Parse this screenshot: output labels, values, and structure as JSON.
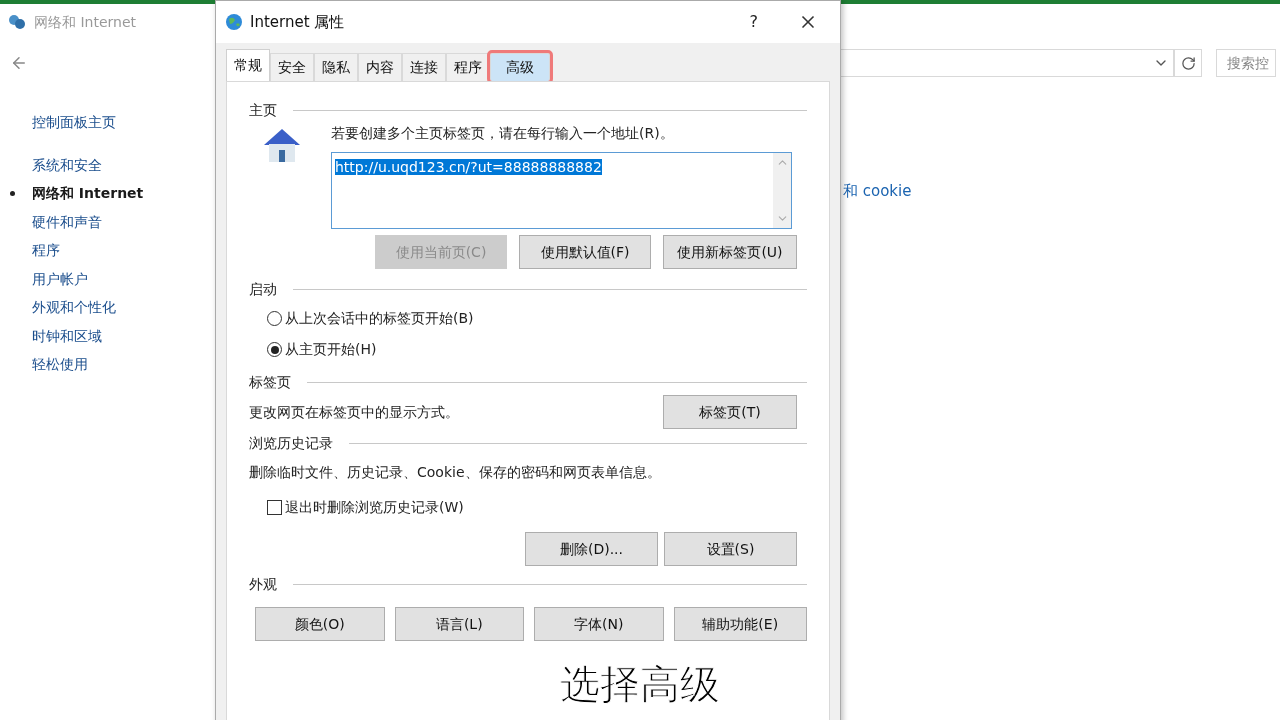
{
  "control_panel": {
    "title": "网络和 Internet",
    "sidebar": [
      {
        "label": "控制面板主页",
        "selected": false
      },
      {
        "label": "系统和安全",
        "selected": false
      },
      {
        "label": "网络和 Internet",
        "selected": true
      },
      {
        "label": "硬件和声音",
        "selected": false
      },
      {
        "label": "程序",
        "selected": false
      },
      {
        "label": "用户帐户",
        "selected": false
      },
      {
        "label": "外观和个性化",
        "selected": false
      },
      {
        "label": "时钟和区域",
        "selected": false
      },
      {
        "label": "轻松使用",
        "selected": false
      }
    ],
    "search": {
      "placeholder": "搜索控"
    },
    "link": "和 cookie"
  },
  "dialog": {
    "title": "Internet 属性",
    "help": "?",
    "tabs": [
      {
        "label": "常规",
        "selected": true,
        "highlighted": false
      },
      {
        "label": "安全",
        "selected": false,
        "highlighted": false
      },
      {
        "label": "隐私",
        "selected": false,
        "highlighted": false
      },
      {
        "label": "内容",
        "selected": false,
        "highlighted": false
      },
      {
        "label": "连接",
        "selected": false,
        "highlighted": false
      },
      {
        "label": "程序",
        "selected": false,
        "highlighted": false
      },
      {
        "label": "高级",
        "selected": false,
        "highlighted": true
      }
    ],
    "homepage": {
      "header": "主页",
      "hint": "若要创建多个主页标签页，请在每行输入一个地址(R)。",
      "value": "http://u.uqd123.cn/?ut=88888888882",
      "buttons": [
        {
          "label": "使用当前页(C)",
          "disabled": true
        },
        {
          "label": "使用默认值(F)",
          "disabled": false
        },
        {
          "label": "使用新标签页(U)",
          "disabled": false
        }
      ]
    },
    "startup": {
      "header": "启动",
      "options": [
        {
          "label": "从上次会话中的标签页开始(B)",
          "selected": false
        },
        {
          "label": "从主页开始(H)",
          "selected": true
        }
      ]
    },
    "tabs_section": {
      "header": "标签页",
      "text": "更改网页在标签页中的显示方式。",
      "button": "标签页(T)"
    },
    "history": {
      "header": "浏览历史记录",
      "text": "删除临时文件、历史记录、Cookie、保存的密码和网页表单信息。",
      "checkbox": {
        "label": "退出时删除浏览历史记录(W)",
        "checked": false
      },
      "buttons": [
        "删除(D)...",
        "设置(S)"
      ]
    },
    "appearance": {
      "header": "外观",
      "buttons": [
        "颜色(O)",
        "语言(L)",
        "字体(N)",
        "辅助功能(E)"
      ]
    }
  },
  "subtitle": "选择高级"
}
